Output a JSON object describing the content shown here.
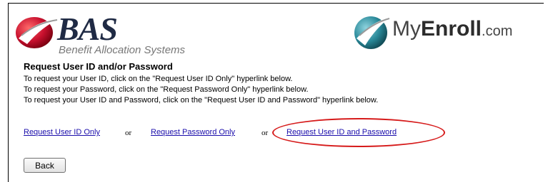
{
  "logos": {
    "bas_name": "BAS",
    "bas_subtitle": "Benefit Allocation Systems",
    "myenroll_prefix": "My",
    "myenroll_strong": "Enroll",
    "myenroll_suffix": ".com"
  },
  "content": {
    "title": "Request User ID and/or Password",
    "lines": [
      "To request your User ID, click on the \"Request User ID Only\" hyperlink below.",
      "To request your Password, click on the \"Request Password Only\" hyperlink below.",
      "To request your User ID and Password, click on the \"Request User ID and Password\" hyperlink below."
    ]
  },
  "links": {
    "user_id_only": "Request User ID Only",
    "password_only": "Request Password Only",
    "user_id_and_password": "Request User ID and Password",
    "separator": "or"
  },
  "buttons": {
    "back": "Back"
  },
  "colors": {
    "link": "#1a0dab",
    "highlight": "#d61a1a",
    "logo_red": "#c8102e",
    "logo_teal": "#2a8a9a"
  }
}
